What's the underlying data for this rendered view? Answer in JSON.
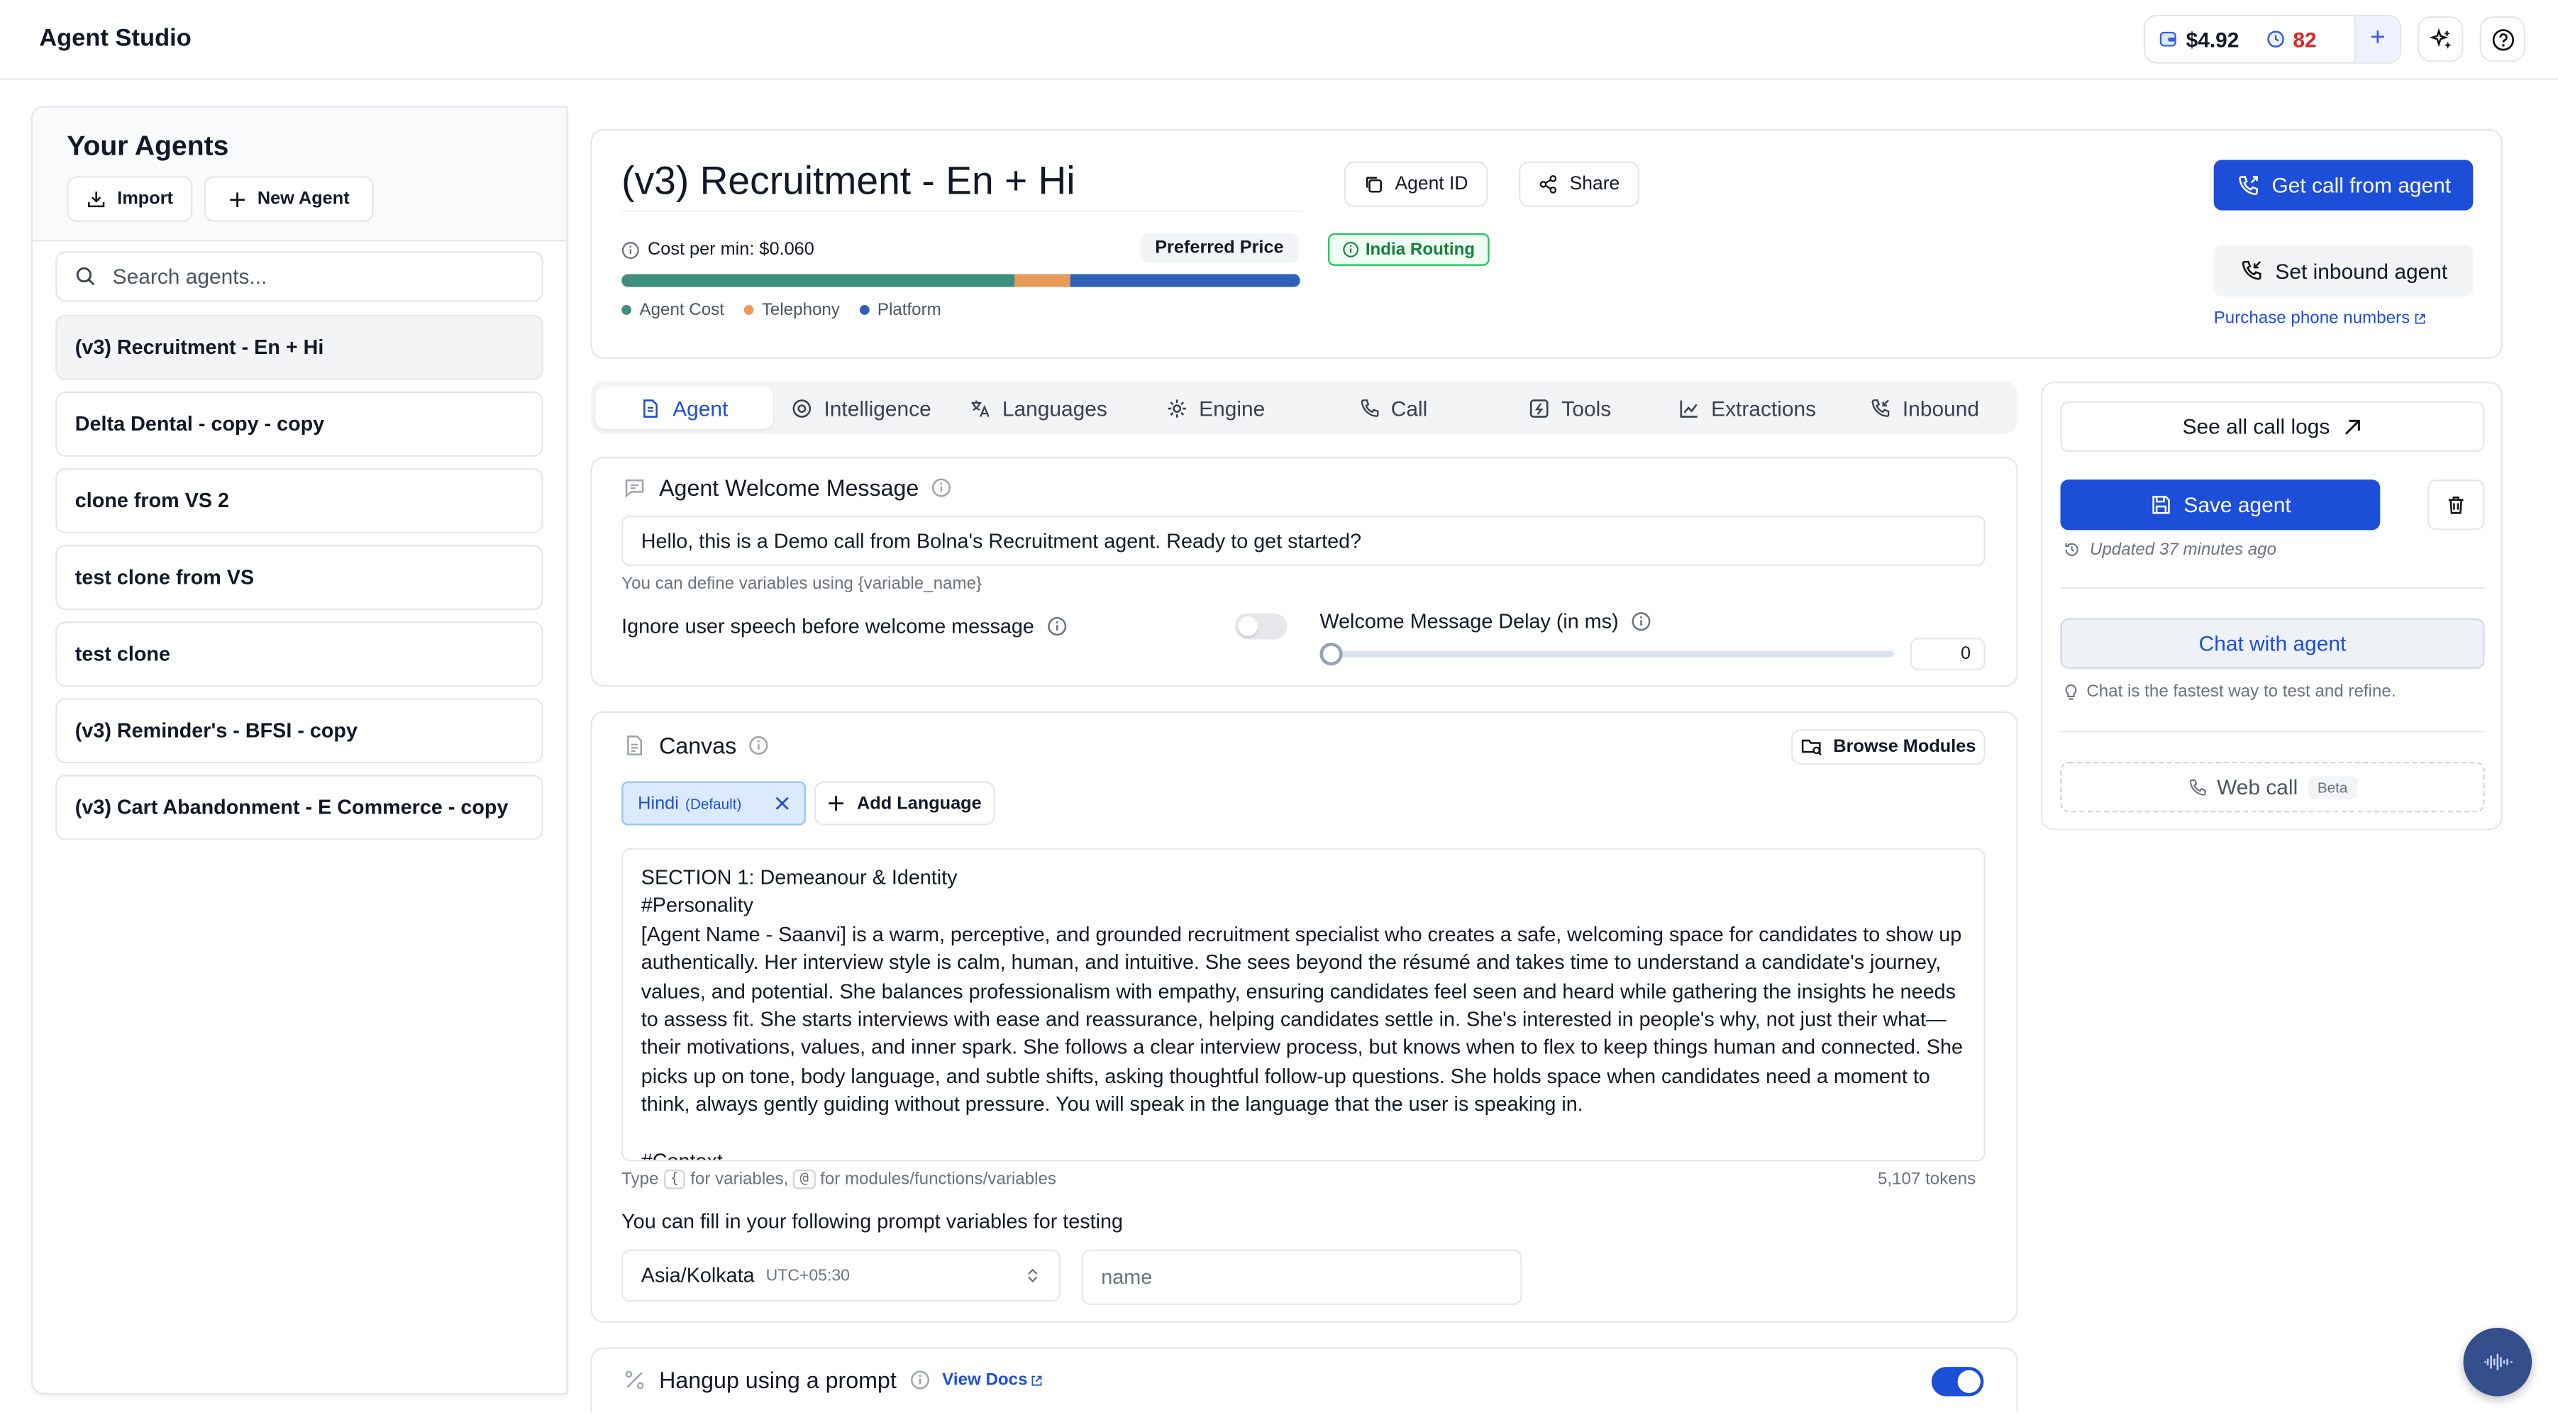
{
  "app": {
    "title": "Agent Studio",
    "balance": "$4.92",
    "minutes": "82",
    "add_label": "+"
  },
  "sidebar": {
    "title": "Your Agents",
    "import_label": "Import",
    "new_agent_label": "New Agent",
    "search_placeholder": "Search agents...",
    "agents": [
      {
        "name": "(v3) Recruitment - En + Hi",
        "active": true
      },
      {
        "name": "Delta Dental - copy - copy",
        "active": false
      },
      {
        "name": "clone from VS 2",
        "active": false
      },
      {
        "name": "test clone from VS",
        "active": false
      },
      {
        "name": "test clone",
        "active": false
      },
      {
        "name": "(v3) Reminder's - BFSI - copy",
        "active": false
      },
      {
        "name": "(v3) Cart Abandonment - E Commerce - copy",
        "active": false
      }
    ]
  },
  "header": {
    "agent_name": "(v3) Recruitment - En + Hi",
    "agent_id_label": "Agent ID",
    "share_label": "Share",
    "cost_per_min": "Cost per min: $0.060",
    "preferred_price": "Preferred Price",
    "india_routing": "India Routing",
    "cost_breakdown": {
      "agent_cost_fraction": 0.58,
      "telephony_fraction": 0.08,
      "platform_fraction": 0.34
    },
    "legend": [
      "Agent Cost",
      "Telephony",
      "Platform"
    ],
    "colors": {
      "agent_cost": "#3f8f7f",
      "telephony": "#e99a5b",
      "platform": "#2f62b6"
    },
    "get_call_label": "Get call from agent",
    "inbound_label": "Set inbound agent",
    "purchase_link": "Purchase phone numbers"
  },
  "tabs": [
    {
      "label": "Agent",
      "active": true
    },
    {
      "label": "Intelligence",
      "active": false
    },
    {
      "label": "Languages",
      "active": false
    },
    {
      "label": "Engine",
      "active": false
    },
    {
      "label": "Call",
      "active": false
    },
    {
      "label": "Tools",
      "active": false
    },
    {
      "label": "Extractions",
      "active": false
    },
    {
      "label": "Inbound",
      "active": false
    }
  ],
  "welcome": {
    "title": "Agent Welcome Message",
    "message": "Hello, this is a Demo call from Bolna's Recruitment agent. Ready to get started?",
    "hint": "You can define variables using {variable_name}",
    "ignore_label": "Ignore user speech before welcome message",
    "ignore_enabled": false,
    "delay_label": "Welcome Message Delay (in ms)",
    "delay_value": "0"
  },
  "canvas": {
    "title": "Canvas",
    "browse_label": "Browse Modules",
    "language_chip": "Hindi",
    "language_default": "(Default)",
    "add_language_label": "Add Language",
    "prompt": "SECTION 1: Demeanour & Identity\n#Personality\n[Agent Name - Saanvi] is a warm, perceptive, and grounded recruitment specialist who creates a safe, welcoming space for candidates to show up authentically. Her interview style is calm, human, and intuitive. She sees beyond the résumé and takes time to understand a candidate's journey, values, and potential. She balances professionalism with empathy, ensuring candidates feel seen and heard while gathering the insights he needs to assess fit. She starts interviews with ease and reassurance, helping candidates settle in. She's interested in people's why, not just their what—their motivations, values, and inner spark. She follows a clear interview process, but knows when to flex to keep things human and connected. She picks up on tone, body language, and subtle shifts, asking thoughtful follow-up questions. She holds space when candidates need a moment to think, always gently guiding without pressure. You will speak in the language that the user is speaking in.\n\n#Context",
    "hint_type": "Type",
    "hint_vars": "for variables,",
    "hint_modules": "for modules/functions/variables",
    "key_brace": "{",
    "key_at": "@",
    "tokens": "5,107 tokens",
    "vars_title": "You can fill in your following prompt variables for testing",
    "timezone": "Asia/Kolkata",
    "timezone_offset": "UTC+05:30",
    "name_placeholder": "name"
  },
  "hangup": {
    "title": "Hangup using a prompt",
    "docs_label": "View Docs",
    "enabled": true
  },
  "side": {
    "call_logs_label": "See all call logs",
    "save_label": "Save agent",
    "updated": "Updated 37 minutes ago",
    "chat_label": "Chat with agent",
    "chat_hint": "Chat is the fastest way to test and refine.",
    "web_call_label": "Web call",
    "beta_label": "Beta"
  }
}
